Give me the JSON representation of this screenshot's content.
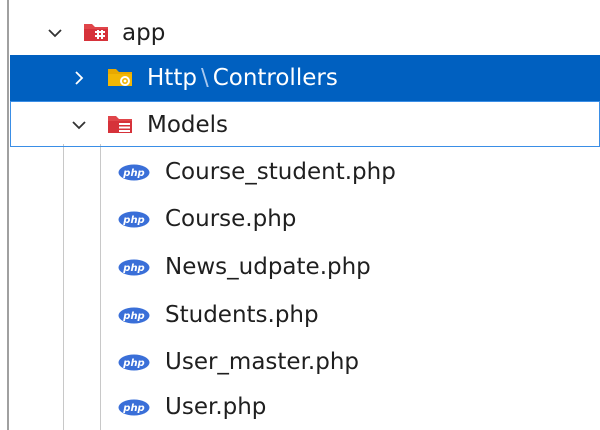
{
  "tree": {
    "app": {
      "label": "app",
      "icon": "folder-app-icon",
      "expanded": true
    },
    "http": {
      "part1": "Http",
      "separator": "\\",
      "part2": "Controllers",
      "icon": "folder-settings-icon",
      "expanded": false,
      "selected": true
    },
    "models": {
      "label": "Models",
      "icon": "folder-models-icon",
      "expanded": true
    },
    "files": [
      {
        "label": "Course_student.php",
        "icon": "php-icon"
      },
      {
        "label": "Course.php",
        "icon": "php-icon"
      },
      {
        "label": "News_udpate.php",
        "icon": "php-icon"
      },
      {
        "label": "Students.php",
        "icon": "php-icon"
      },
      {
        "label": "User_master.php",
        "icon": "php-icon"
      },
      {
        "label": "User.php",
        "icon": "php-icon"
      }
    ]
  },
  "colors": {
    "selection": "#0060c0",
    "folder_red": "#e0454a",
    "folder_yellow": "#f2b705",
    "php_blue": "#3a6fd8"
  }
}
